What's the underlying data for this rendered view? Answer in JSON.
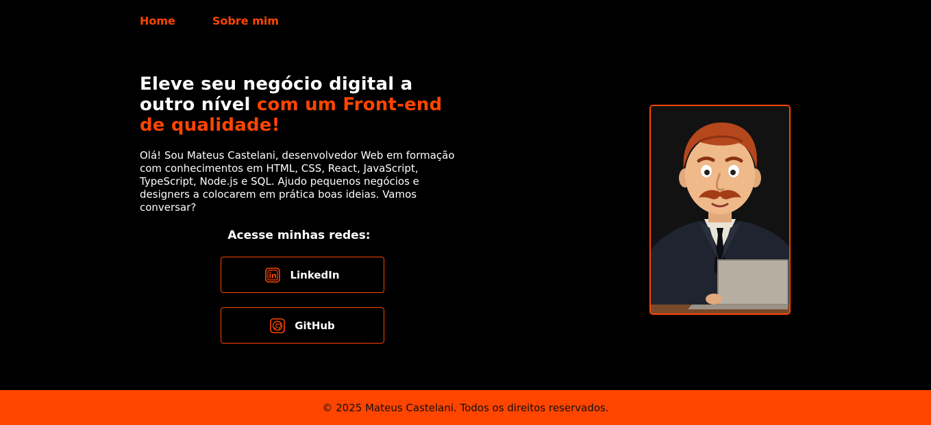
{
  "nav": {
    "items": [
      {
        "label": "Home"
      },
      {
        "label": "Sobre mim"
      }
    ]
  },
  "hero": {
    "headline_part1": "Eleve seu negócio digital a outro nível ",
    "headline_accent": "com um Front-end de qualidade!",
    "intro": "Olá! Sou Mateus Castelani, desenvolvedor Web em formação com conhecimentos em HTML, CSS, React, JavaScript, TypeScript, Node.js e SQL. Ajudo pequenos negócios e designers a colocarem em prática boas ideias. Vamos conversar?"
  },
  "social": {
    "title": "Acesse minhas redes:",
    "links": [
      {
        "label": "LinkedIn",
        "icon": "linkedin-icon"
      },
      {
        "label": "GitHub",
        "icon": "github-icon"
      }
    ]
  },
  "footer": {
    "text": "© 2025 Mateus Castelani. Todos os direitos reservados."
  },
  "colors": {
    "background": "#000000",
    "accent": "#ff4500",
    "text": "#ffffff"
  }
}
